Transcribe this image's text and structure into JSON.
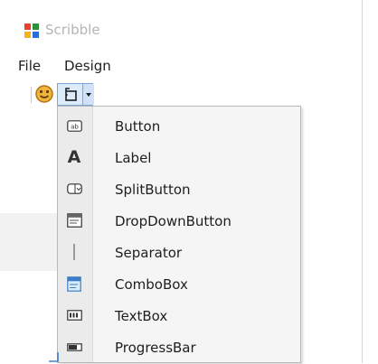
{
  "window": {
    "title": "Scribble"
  },
  "menu": [
    {
      "label": "File"
    },
    {
      "label": "Design"
    }
  ],
  "toolbar": {
    "smiley_icon": "smiley-icon",
    "split_icon": "toolstrip-icon"
  },
  "dropdown": {
    "items": [
      {
        "label": "Button",
        "icon": "button-icon"
      },
      {
        "label": "Label",
        "icon": "label-icon"
      },
      {
        "label": "SplitButton",
        "icon": "split-button-icon"
      },
      {
        "label": "DropDownButton",
        "icon": "drop-down-button-icon"
      },
      {
        "label": "Separator",
        "icon": "separator-icon"
      },
      {
        "label": "ComboBox",
        "icon": "combo-box-icon"
      },
      {
        "label": "TextBox",
        "icon": "text-box-icon"
      },
      {
        "label": "ProgressBar",
        "icon": "progress-bar-icon"
      }
    ]
  },
  "colors": {
    "accent": "#3e7ec7",
    "title_text": "#b4b4b4",
    "menu_bg": "#f5f5f5",
    "split_hover": "#dcebfb"
  }
}
